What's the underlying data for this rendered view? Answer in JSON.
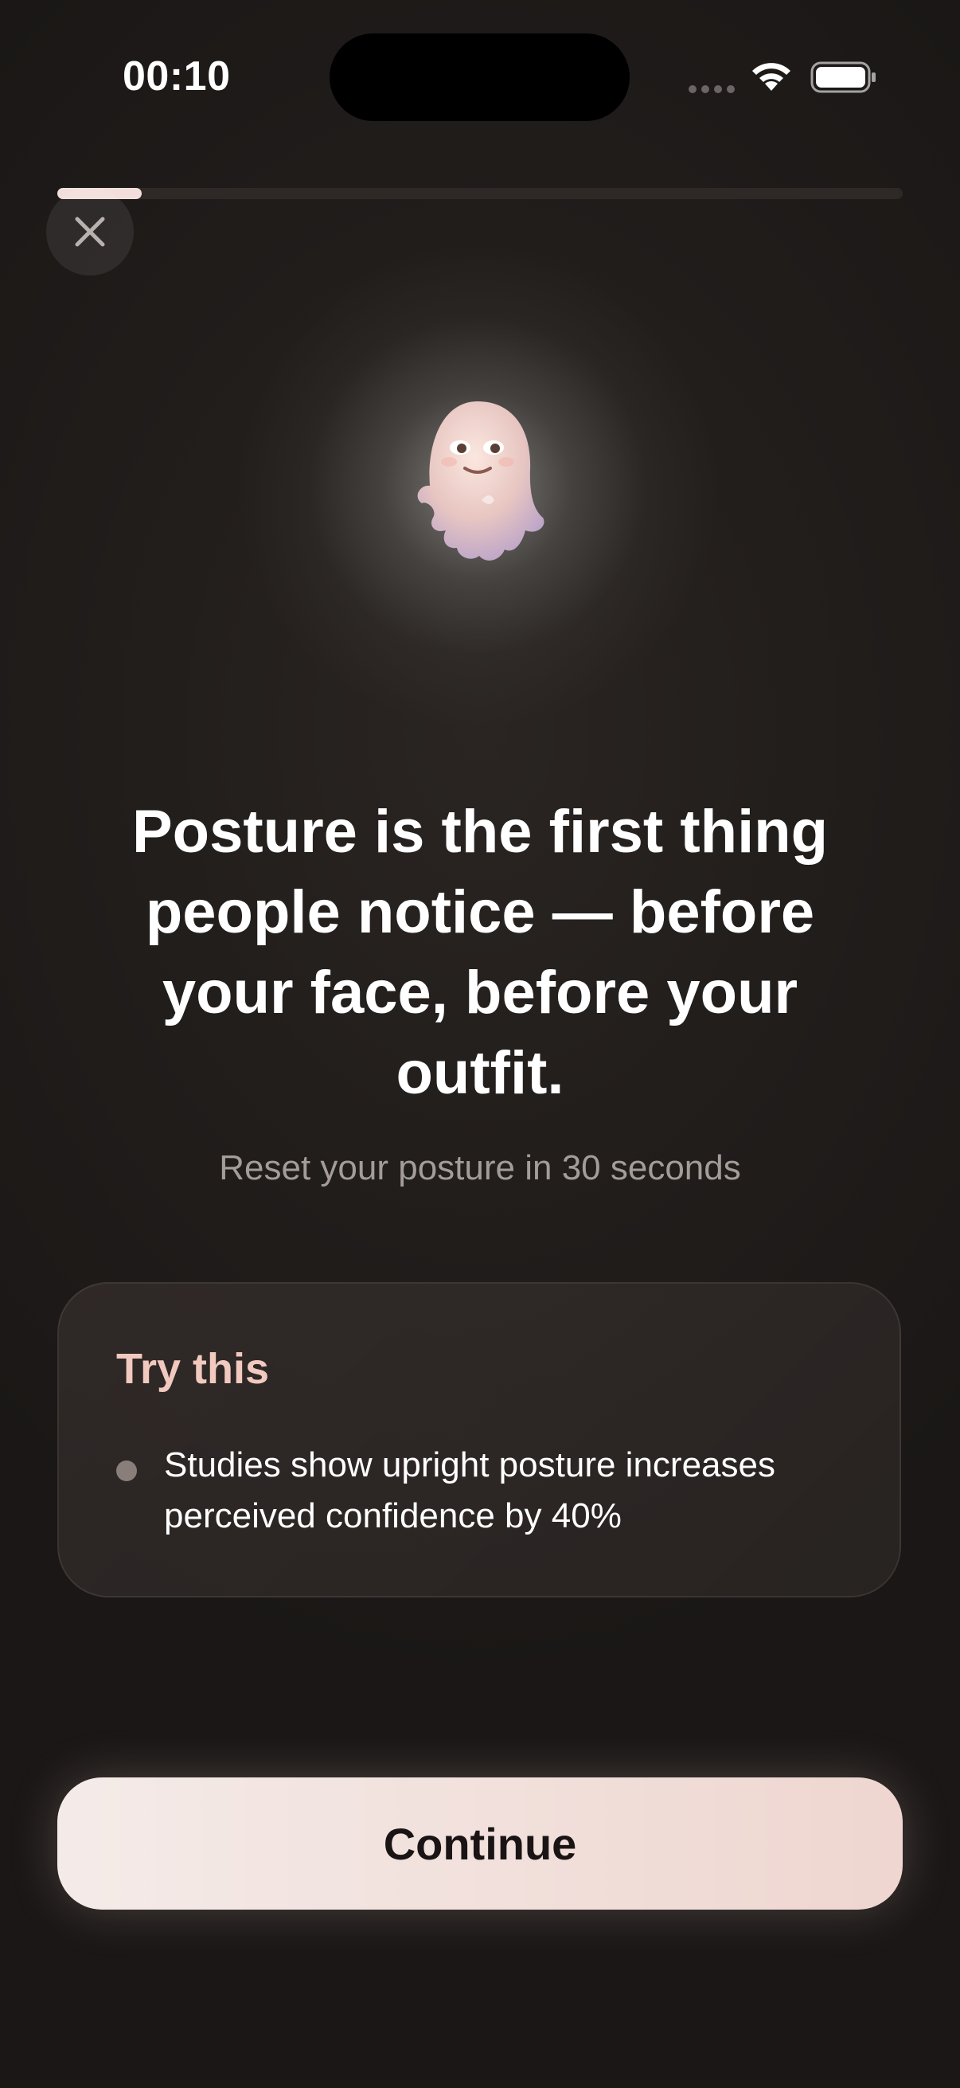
{
  "status_bar": {
    "time": "00:10"
  },
  "progress": {
    "fraction": 0.1
  },
  "icons": {
    "close": "close-icon",
    "mascot": "ghost-mascot-icon",
    "wifi": "wifi-icon",
    "battery": "battery-icon",
    "signal": "cellular-signal-icon"
  },
  "main": {
    "headline": "Posture is the first thing people notice — before your face, before your outfit.",
    "subtitle": "Reset your posture in 30 seconds"
  },
  "tip_card": {
    "title": "Try this",
    "items": [
      "Studies show upright posture increases perceived confidence by 40%"
    ]
  },
  "footer": {
    "continue_label": "Continue"
  },
  "colors": {
    "background": "#1c1817",
    "accent": "#f1c9bf",
    "button_start": "#f4ebe8",
    "button_end": "#efd6d0"
  }
}
